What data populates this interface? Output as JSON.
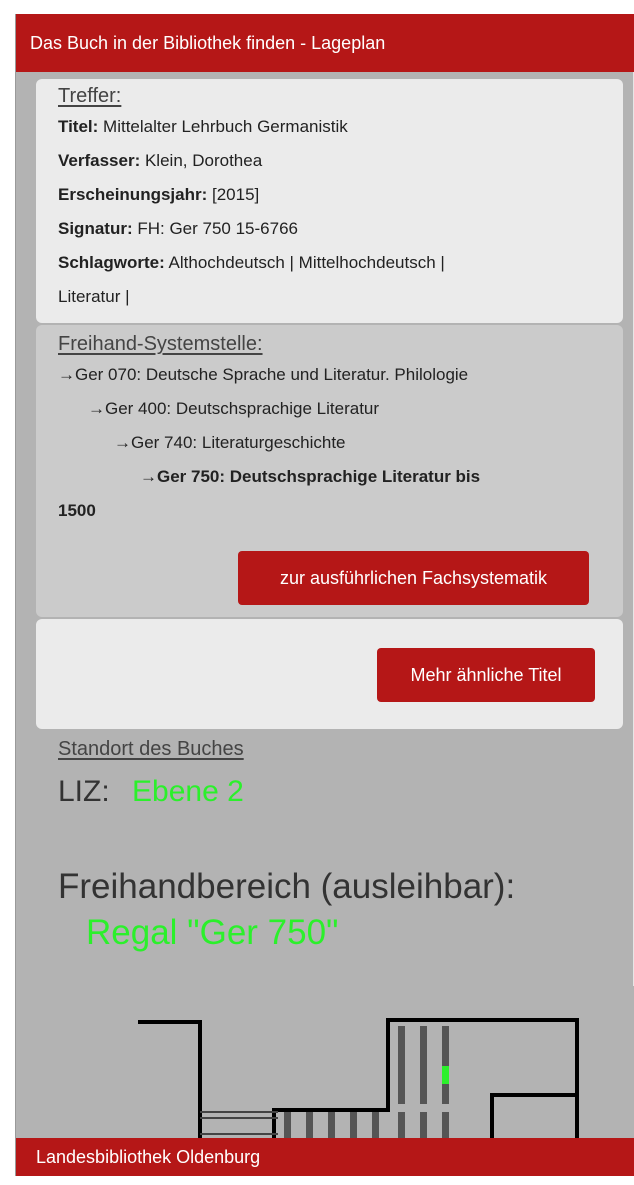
{
  "header": {
    "title": "Das Buch in der Bibliothek finden - Lageplan"
  },
  "result": {
    "heading": "Treffer:",
    "title_label": "Titel:",
    "title_value": "Mittelalter Lehrbuch Germanistik",
    "author_label": "Verfasser:",
    "author_value": "Klein, Dorothea",
    "year_label": "Erscheinungsjahr:",
    "year_value": "[2015]",
    "signature_label": "Signatur:",
    "signature_value": "FH: Ger 750 15-6766",
    "keywords_label": "Schlagworte:",
    "keywords_value_line1": "Althochdeutsch | Mittelhochdeutsch |",
    "keywords_value_line2": "Literatur |"
  },
  "systemstelle": {
    "heading": "Freihand-Systemstelle:",
    "levels": [
      "→Ger 070: Deutsche Sprache und Literatur. Philologie",
      "→Ger 400: Deutschsprachige Literatur",
      "→Ger 740: Literaturgeschichte",
      "→Ger 750: Deutschsprachige Literatur bis"
    ],
    "level4_continuation": "1500",
    "button_label": "zur ausführlichen Fachsystematik"
  },
  "similar": {
    "button_label": "Mehr ähnliche Titel"
  },
  "location": {
    "heading": "Standort des Buches",
    "building_label": "LIZ:",
    "level_value": "Ebene 2",
    "area_label": "Freihandbereich (ausleihbar):",
    "shelf_value": "Regal \"Ger 750\""
  },
  "footer": {
    "text": "Landesbibliothek Oldenburg"
  },
  "colors": {
    "brand_red": "#b51717",
    "highlight_green": "#2bf02b",
    "panel_grey": "#b3b3b3"
  }
}
